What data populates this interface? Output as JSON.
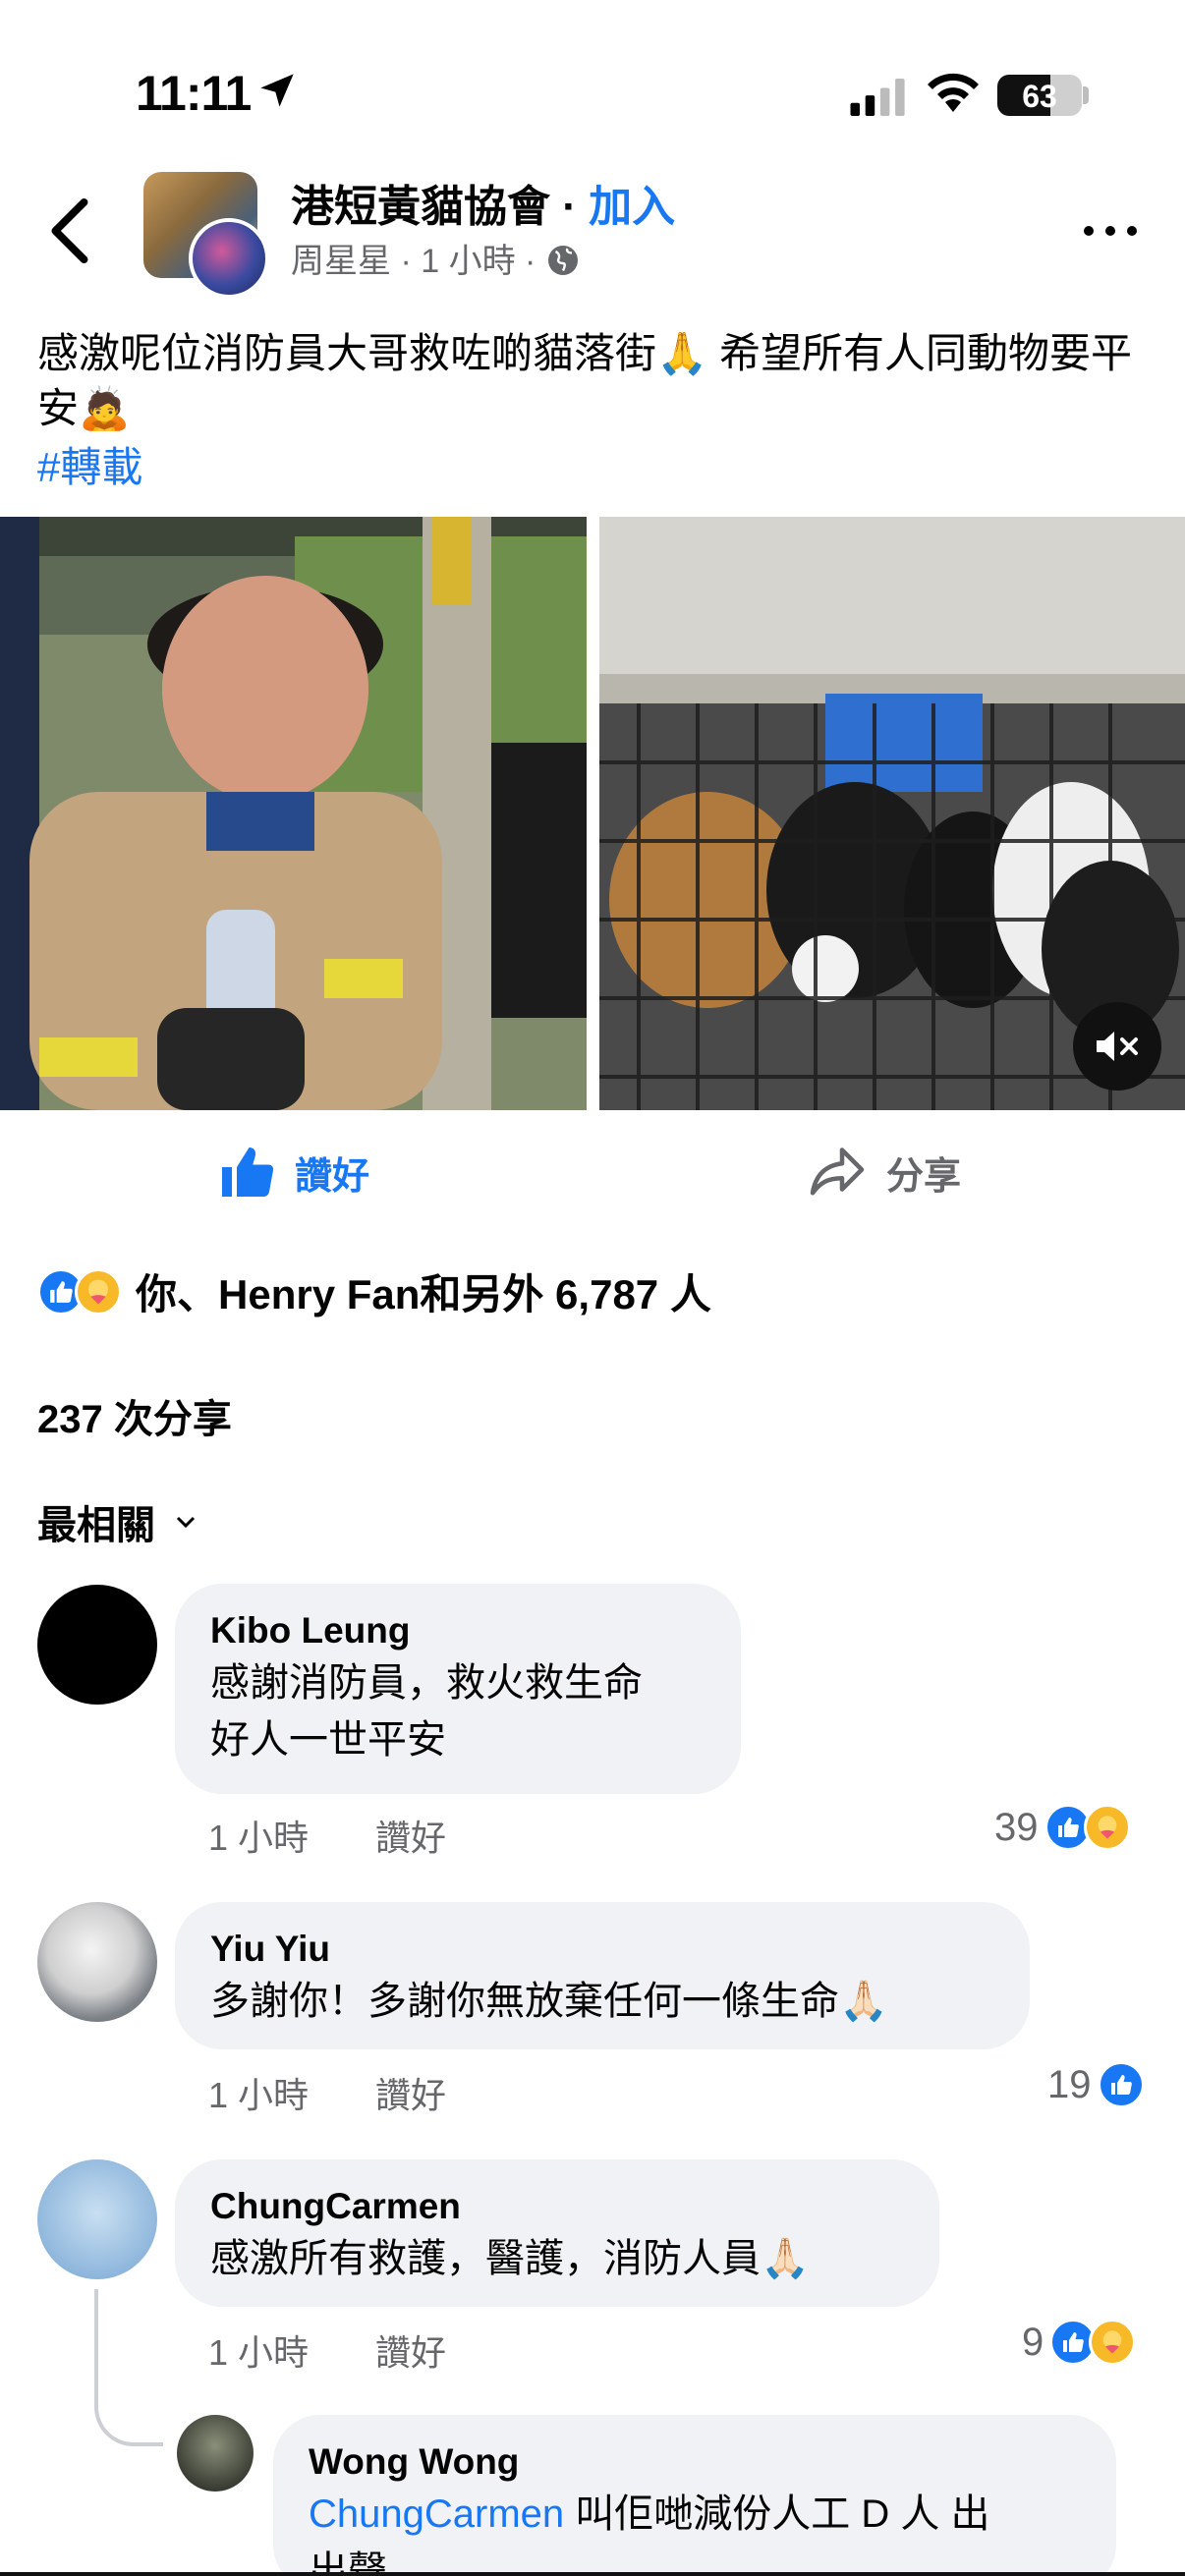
{
  "status": {
    "time": "11:11",
    "battery": "63"
  },
  "header": {
    "group_name": "港短黃貓協會",
    "separator": " · ",
    "join_label": "加入",
    "author": "周星星",
    "meta_time": "1 小時",
    "meta_sep": " · "
  },
  "post": {
    "text": "感激呢位消防員大哥救咗啲貓落街🙏 希望所有人同動物要平安🙇",
    "hashtag": "#轉載"
  },
  "actions": {
    "like_label": "讚好",
    "share_label": "分享"
  },
  "reactions_summary": "你、Henry Fan和另外 6,787 人",
  "shares": "237 次分享",
  "sort_label": "最相關",
  "comments": [
    {
      "name": "Kibo Leung",
      "lines": [
        "感謝消防員，救火救生命",
        "好人一世平安"
      ],
      "time": "1 小時",
      "like_label": "讚好",
      "count": "39"
    },
    {
      "name": "Yiu Yiu",
      "lines": [
        "多謝你！多謝你無放棄任何一條生命🙏🏻"
      ],
      "time": "1 小時",
      "like_label": "讚好",
      "count": "19"
    },
    {
      "name": "ChungCarmen",
      "lines": [
        "感激所有救護，醫護，消防人員🙏🏻"
      ],
      "time": "1 小時",
      "like_label": "讚好",
      "count": "9"
    },
    {
      "name": "Wong Wong",
      "mention": "ChungCarmen",
      "text": " 叫佢哋減份人工 D 人 出",
      "text2": "出聲"
    }
  ],
  "colors": {
    "brand": "#1877f2",
    "muted": "#65676b",
    "bubble": "#f0f2f5",
    "care": "#f7b928"
  },
  "icons": [
    "location-arrow-icon",
    "signal-icon",
    "wifi-icon",
    "battery-icon",
    "back-arrow-icon",
    "globe-icon",
    "more-icon",
    "mute-icon",
    "like-thumb-icon",
    "share-arrow-icon",
    "care-reaction-icon",
    "chevron-down-icon"
  ]
}
